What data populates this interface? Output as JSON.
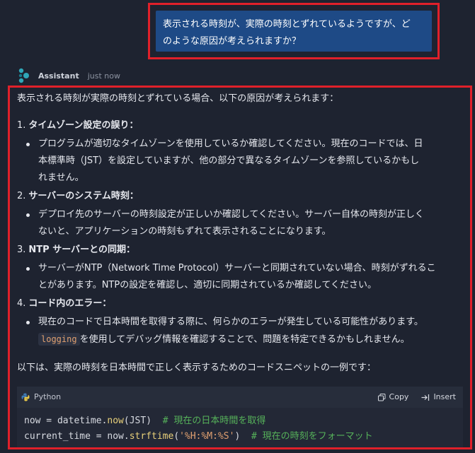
{
  "user_message": {
    "line1": "表示される時刻が、実際の時刻とずれているようですが、ど",
    "line2": "のような原因が考えられますか？"
  },
  "assistant": {
    "name": "Assistant",
    "time": "just now",
    "intro": "表示される時刻が実際の時刻とずれている場合、以下の原因が考えられます：",
    "sections": [
      {
        "num": "1.",
        "title": "タイムゾーン設定の誤り：",
        "lines": [
          "プログラムが適切なタイムゾーンを使用しているか確認してください。現在のコードでは、日",
          "本標準時（JST）を設定していますが、他の部分で異なるタイムゾーンを参照しているかもし",
          "れません。"
        ]
      },
      {
        "num": "2.",
        "title": "サーバーのシステム時刻：",
        "lines": [
          "デプロイ先のサーバーの時刻設定が正しいか確認してください。サーバー自体の時刻が正しく",
          "ないと、アプリケーションの時刻もずれて表示されることになります。"
        ]
      },
      {
        "num": "3.",
        "title": "NTP サーバーとの同期：",
        "lines": [
          "サーバーがNTP（Network Time Protocol）サーバーと同期されていない場合、時刻がずれるこ",
          "とがあります。NTPの設定を確認し、適切に同期されているか確認してください。"
        ]
      },
      {
        "num": "4.",
        "title": "コード内のエラー：",
        "line1": "現在のコードで日本時間を取得する際に、何らかのエラーが発生している可能性があります。",
        "code": "logging",
        "line2_rest": "を使用してデバッグ情報を確認することで、問題を特定できるかもしれません。"
      }
    ],
    "outro": "以下は、実際の時刻を日本時間で正しく表示するためのコードスニペットの一例です：",
    "code_block": {
      "language": "Python",
      "copy_label": "Copy",
      "insert_label": "Insert",
      "line1": {
        "a": "now = datetime.",
        "fn": "now",
        "b": "(JST)  ",
        "comment": "# 現在の日本時間を取得"
      },
      "line2": {
        "a": "current_time = now.",
        "fn": "strftime",
        "b": "(",
        "str": "'%H:%M:%S'",
        "c": ")  ",
        "comment": "# 現在の時刻をフォーマット"
      }
    }
  },
  "colors": {
    "background": "#1e2330",
    "user_bubble": "#1e4a86",
    "highlight_border": "#e0202a",
    "accent_teal": "#2fa7b8"
  }
}
